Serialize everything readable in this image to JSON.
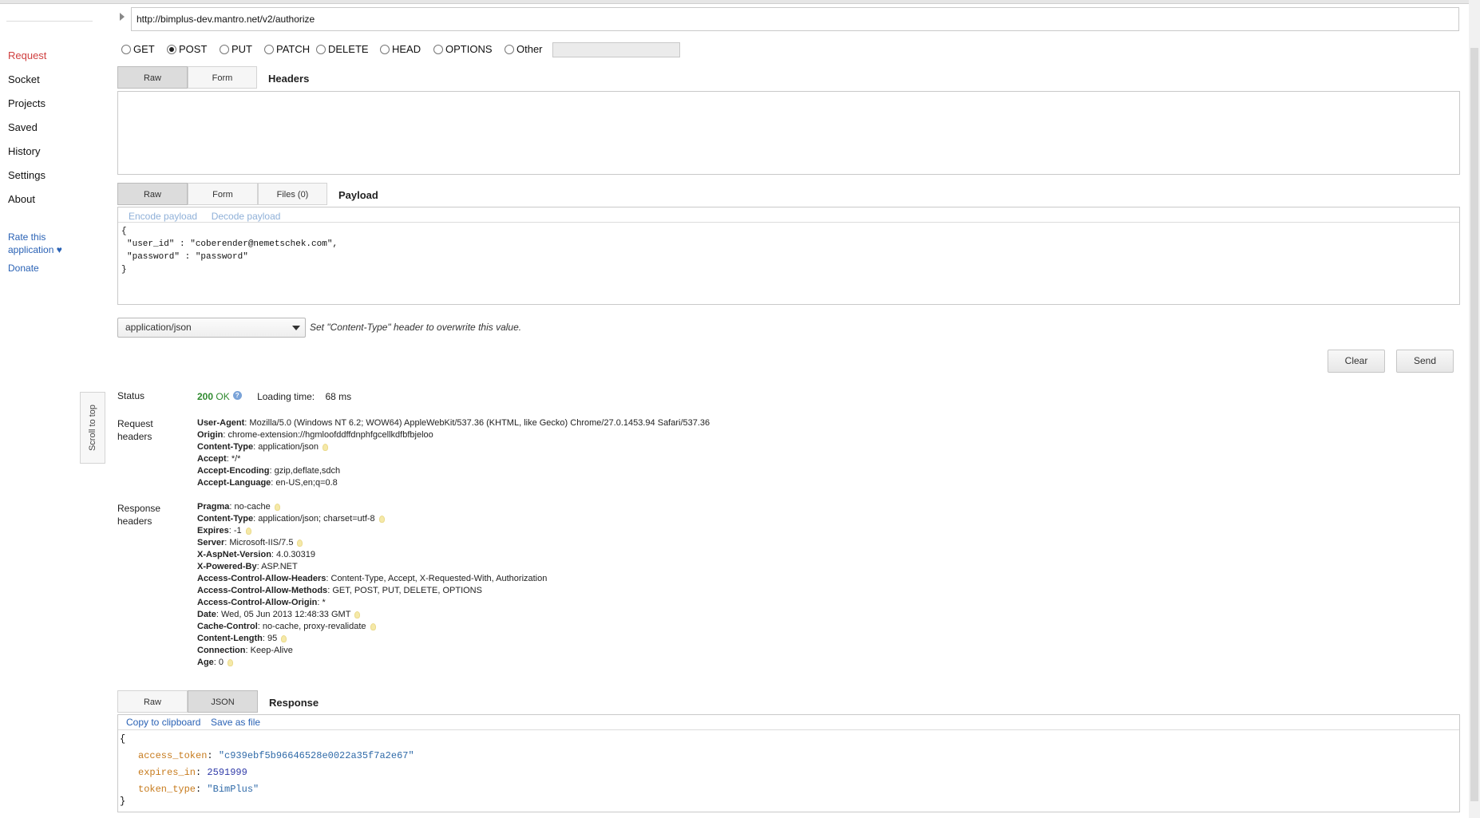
{
  "sidebar": {
    "items": [
      {
        "label": "Request",
        "active": true
      },
      {
        "label": "Socket"
      },
      {
        "label": "Projects"
      },
      {
        "label": "Saved"
      },
      {
        "label": "History"
      },
      {
        "label": "Settings"
      },
      {
        "label": "About"
      }
    ],
    "rate_line1": "Rate this",
    "rate_line2": "application ♥",
    "donate": "Donate",
    "scroll_to_top": "Scroll to top"
  },
  "request": {
    "url": "http://bimplus-dev.mantro.net/v2/authorize",
    "methods": [
      "GET",
      "POST",
      "PUT",
      "PATCH",
      "DELETE",
      "HEAD",
      "OPTIONS",
      "Other"
    ],
    "selected_method": "POST",
    "headers_tabs": [
      "Raw",
      "Form"
    ],
    "headers_title": "Headers",
    "payload_tabs": [
      "Raw",
      "Form",
      "Files (0)"
    ],
    "payload_title": "Payload",
    "encode_payload": "Encode payload",
    "decode_payload": "Decode payload",
    "payload_lines": [
      "{",
      "\"user_id\" : \"coberender@nemetschek.com\",",
      "\"password\" : \"password\"",
      "}"
    ],
    "content_type": "application/json",
    "content_type_hint": "Set \"Content-Type\" header to overwrite this value.",
    "clear_button": "Clear",
    "send_button": "Send"
  },
  "result": {
    "status_label": "Status",
    "status_code": "200",
    "status_text": "OK",
    "loading_label": "Loading time:",
    "loading_value": "68 ms",
    "request_headers_label1": "Request",
    "request_headers_label2": "headers",
    "request_headers": [
      {
        "name": "User-Agent",
        "value": "Mozilla/5.0 (Windows NT 6.2; WOW64) AppleWebKit/537.36 (KHTML, like Gecko) Chrome/27.0.1453.94 Safari/537.36",
        "hint": false
      },
      {
        "name": "Origin",
        "value": "chrome-extension://hgmloofddffdnphfgcellkdfbfbjeloo",
        "hint": false
      },
      {
        "name": "Content-Type",
        "value": "application/json",
        "hint": true
      },
      {
        "name": "Accept",
        "value": "*/*",
        "hint": false
      },
      {
        "name": "Accept-Encoding",
        "value": "gzip,deflate,sdch",
        "hint": false
      },
      {
        "name": "Accept-Language",
        "value": "en-US,en;q=0.8",
        "hint": false
      }
    ],
    "response_headers_label1": "Response",
    "response_headers_label2": "headers",
    "response_headers": [
      {
        "name": "Pragma",
        "value": "no-cache",
        "hint": true
      },
      {
        "name": "Content-Type",
        "value": "application/json; charset=utf-8",
        "hint": true
      },
      {
        "name": "Expires",
        "value": "-1",
        "hint": true
      },
      {
        "name": "Server",
        "value": "Microsoft-IIS/7.5",
        "hint": true
      },
      {
        "name": "X-AspNet-Version",
        "value": "4.0.30319",
        "hint": false
      },
      {
        "name": "X-Powered-By",
        "value": "ASP.NET",
        "hint": false
      },
      {
        "name": "Access-Control-Allow-Headers",
        "value": "Content-Type, Accept, X-Requested-With, Authorization",
        "hint": false
      },
      {
        "name": "Access-Control-Allow-Methods",
        "value": "GET, POST, PUT, DELETE, OPTIONS",
        "hint": false
      },
      {
        "name": "Access-Control-Allow-Origin",
        "value": "*",
        "hint": false
      },
      {
        "name": "Date",
        "value": "Wed, 05 Jun 2013 12:48:33 GMT",
        "hint": true
      },
      {
        "name": "Cache-Control",
        "value": "no-cache, proxy-revalidate",
        "hint": true
      },
      {
        "name": "Content-Length",
        "value": "95",
        "hint": true
      },
      {
        "name": "Connection",
        "value": "Keep-Alive",
        "hint": false
      },
      {
        "name": "Age",
        "value": "0",
        "hint": true
      }
    ],
    "response_tabs": [
      "Raw",
      "JSON"
    ],
    "response_title": "Response",
    "copy_clipboard": "Copy to clipboard",
    "save_as_file": "Save as file",
    "json_open": "{",
    "json_close": "}",
    "json_fields": [
      {
        "key": "access_token",
        "value": "\"c939ebf5b96646528e0022a35f7a2e67\"",
        "type": "string"
      },
      {
        "key": "expires_in",
        "value": "2591999",
        "type": "number"
      },
      {
        "key": "token_type",
        "value": "\"BimPlus\"",
        "type": "string"
      }
    ]
  }
}
